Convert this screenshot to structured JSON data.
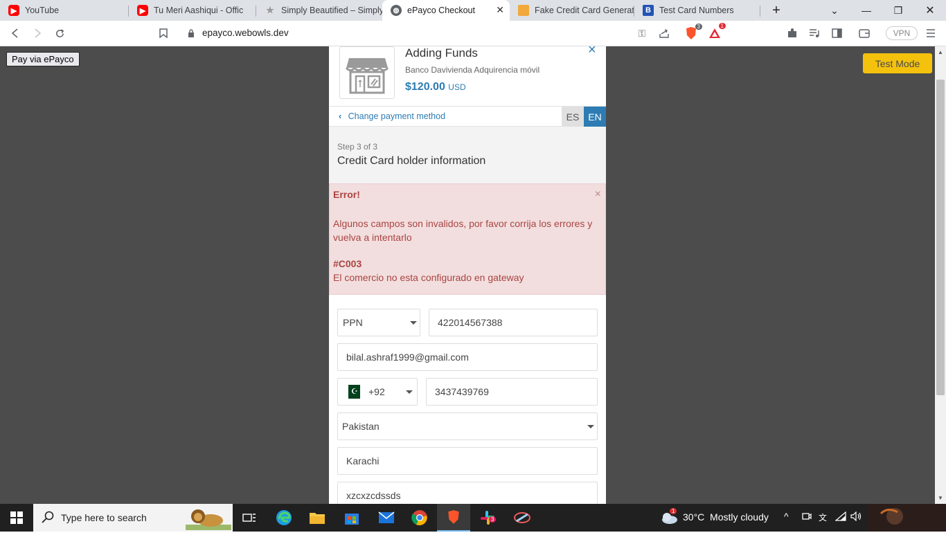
{
  "browser": {
    "tabs": [
      {
        "title": "YouTube",
        "icon": "youtube-icon"
      },
      {
        "title": "Tu Meri Aashiqui - Offic",
        "icon": "youtube-icon"
      },
      {
        "title": "Simply Beautified – Simply",
        "icon": "star-icon"
      },
      {
        "title": "ePayco Checkout",
        "icon": "globe-icon",
        "active": true
      },
      {
        "title": "Fake Credit Card Generator",
        "icon": "card-icon"
      },
      {
        "title": "Test Card Numbers",
        "icon": "b-icon"
      }
    ],
    "new_tab": "+",
    "url": "epayco.webowls.dev",
    "vpn_label": "VPN",
    "brave_badge": "3",
    "alert_badge": "1"
  },
  "page": {
    "pay_button": "Pay via ePayco",
    "test_mode": "Test Mode"
  },
  "checkout": {
    "title": "Adding Funds",
    "merchant": "Banco Davivienda Adquirencia móvil",
    "amount": "$120.00",
    "currency": "USD",
    "close": "×",
    "change_payment": "Change payment method",
    "lang_es": "ES",
    "lang_en": "EN",
    "step": "Step 3 of 3",
    "step_title": "Credit Card holder information",
    "error": {
      "heading": "Error!",
      "message": "Algunos campos son invalidos, por favor corrija los errores y vuelva a intentarlo",
      "code": "#C003",
      "detail": "El comercio no esta configurado en gateway"
    },
    "form": {
      "doc_type": "PPN",
      "doc_number": "422014567388",
      "email": "bilal.ashraf1999@gmail.com",
      "phone_code": "+92",
      "phone": "3437439769",
      "country": "Pakistan",
      "city": "Karachi",
      "address": "xzcxzcdssds"
    }
  },
  "taskbar": {
    "search_placeholder": "Type here to search",
    "weather": "30°C  Mostly cloudy",
    "weather_badge": "1",
    "slack_badge": "3"
  },
  "colors": {
    "accent": "#2d7cb3",
    "test_mode": "#f4c20d",
    "error_bg": "#f2dede",
    "error_text": "#a94442"
  }
}
